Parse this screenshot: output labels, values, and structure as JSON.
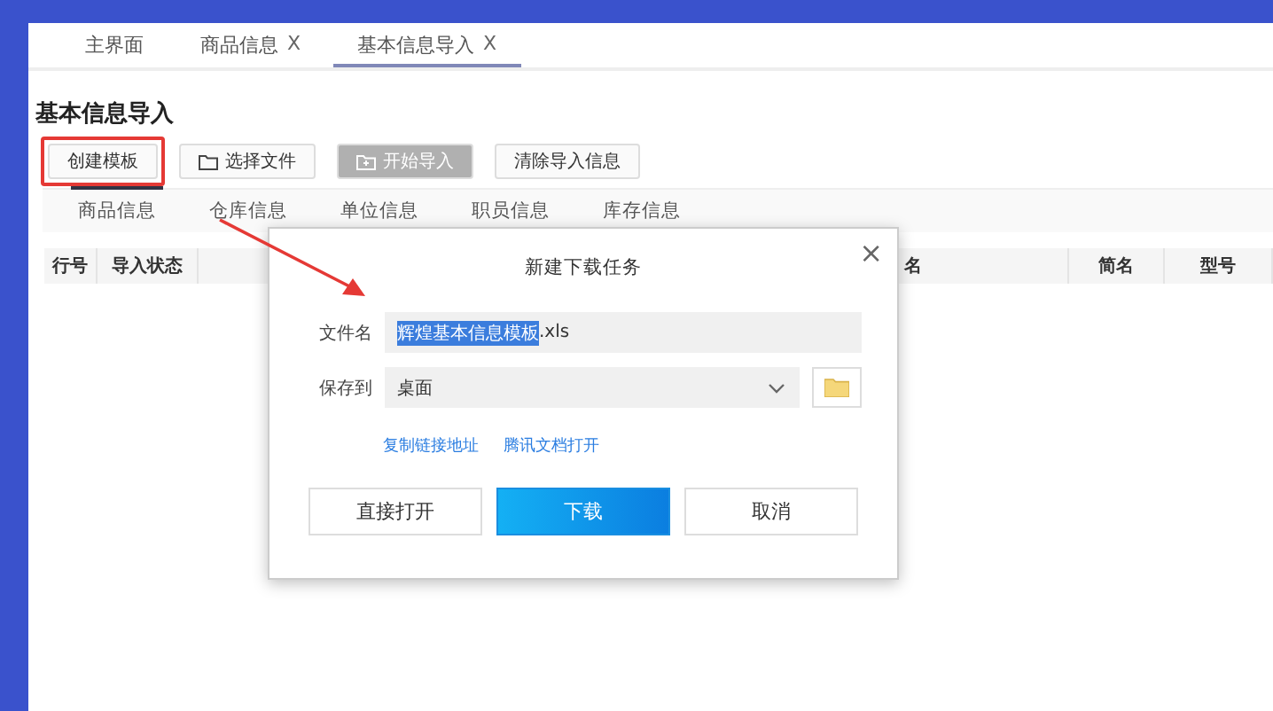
{
  "tabs": [
    {
      "label": "主界面",
      "selected": false
    },
    {
      "label": "商品信息",
      "close": "X",
      "selected": false
    },
    {
      "label": "基本信息导入",
      "close": "X",
      "selected": true
    }
  ],
  "page_title": "基本信息导入",
  "toolbar": [
    {
      "label": "创建模板",
      "kind": "plain",
      "disabled": false,
      "highlighted": true
    },
    {
      "label": "选择文件",
      "kind": "folder",
      "disabled": false,
      "highlighted": false
    },
    {
      "label": "开始导入",
      "kind": "import",
      "disabled": true,
      "highlighted": false
    },
    {
      "label": "清除导入信息",
      "kind": "plain",
      "disabled": false,
      "highlighted": false
    }
  ],
  "sub_tabs": [
    {
      "label": "商品信息",
      "selected": true
    },
    {
      "label": "仓库信息",
      "selected": false
    },
    {
      "label": "单位信息",
      "selected": false
    },
    {
      "label": "职员信息",
      "selected": false
    },
    {
      "label": "库存信息",
      "selected": false
    }
  ],
  "table": {
    "columns": [
      "行号",
      "导入状态",
      "名",
      "简名",
      "型号"
    ]
  },
  "dialog": {
    "title": "新建下载任务",
    "close": "×",
    "file_label": "文件名",
    "file_value": [
      {
        "text": "辉煌基本信息模板",
        "selected": true
      },
      {
        "text": ".xls",
        "selected": false
      }
    ],
    "save_label": "保存到",
    "save_value": "桌面",
    "links": [
      "复制链接地址",
      "腾讯文档打开"
    ],
    "buttons": [
      {
        "label": "直接打开",
        "primary": false
      },
      {
        "label": "下载",
        "primary": true
      },
      {
        "label": "取消",
        "primary": false
      }
    ]
  }
}
